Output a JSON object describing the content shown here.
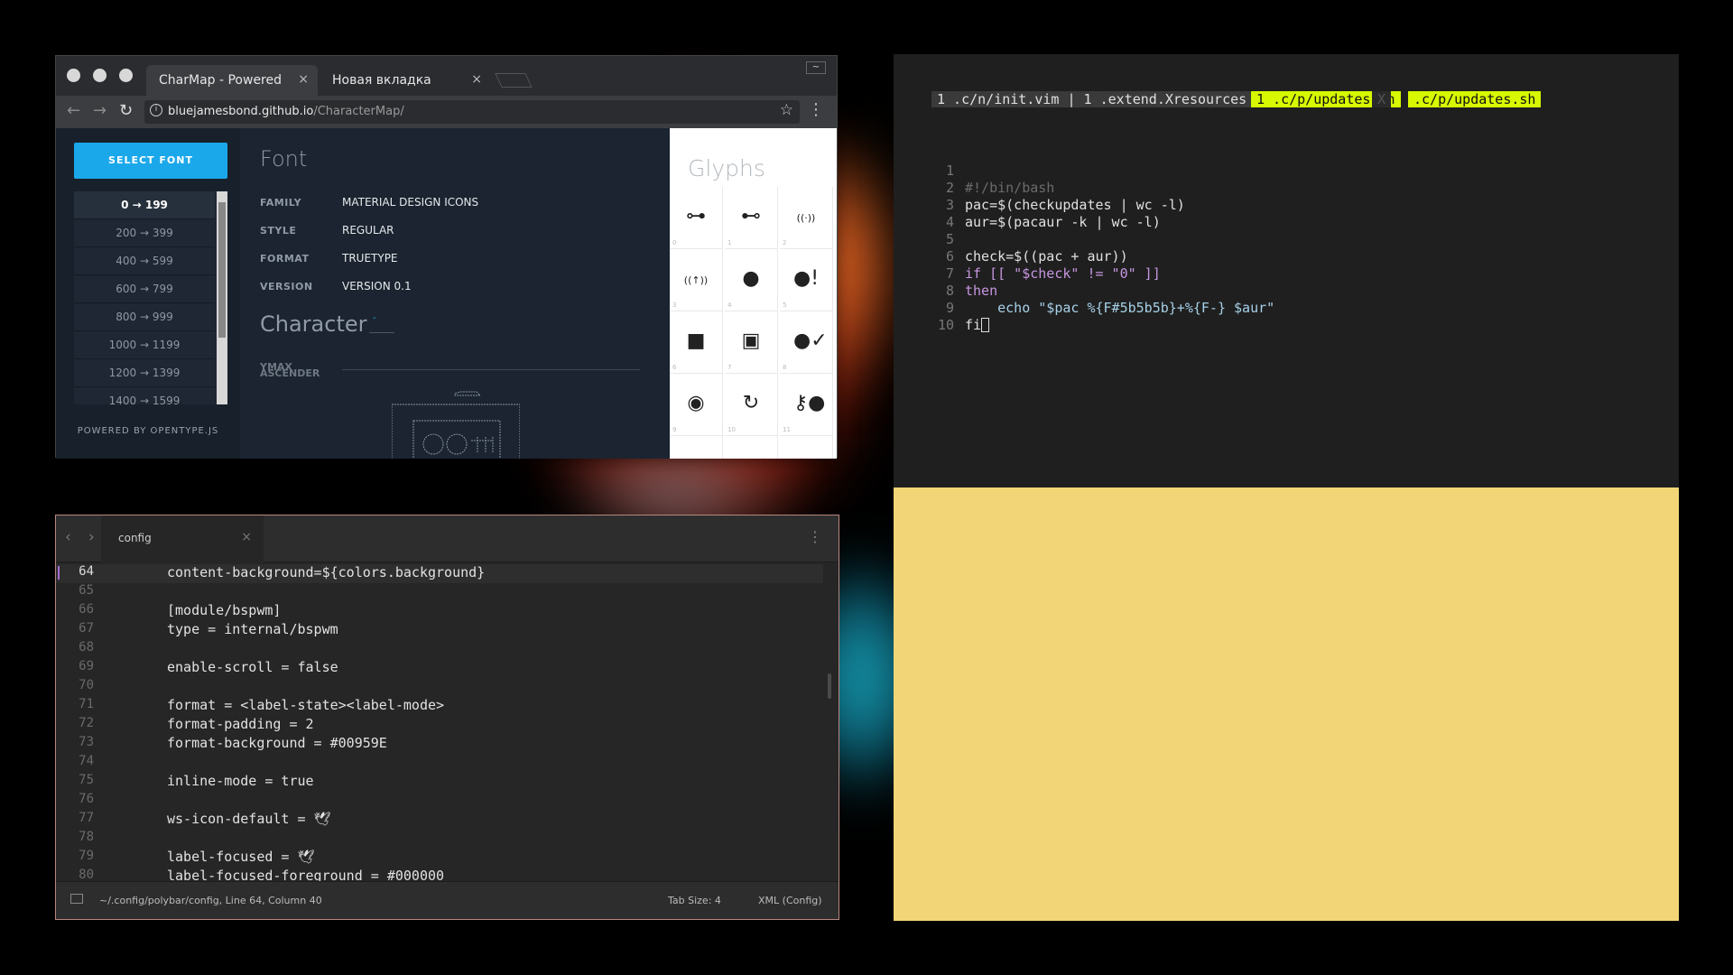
{
  "colors": {
    "accent_blue": "#1ba8ea",
    "vim_tab_highlight": "#d7f800",
    "terminal_bg": "#1f1f1f",
    "yellow_pane": "#f2d576"
  },
  "browser": {
    "tabs": [
      {
        "label": "CharMap - Powered",
        "close": "×"
      },
      {
        "label": "Новая вкладка",
        "close": "×"
      }
    ],
    "url_host": "bluejamesbond.github.io",
    "url_path": "/CharacterMap/",
    "info_icon": "i",
    "minimize": "~",
    "nav": {
      "back": "←",
      "forward": "→",
      "reload": "↻",
      "star": "☆",
      "menu": "⋮"
    }
  },
  "charmap": {
    "select_font_label": "SELECT FONT",
    "ranges": [
      "0 → 199",
      "200 → 399",
      "400 → 599",
      "600 → 799",
      "800 → 999",
      "1000 → 1199",
      "1200 → 1399",
      "1400 → 1599"
    ],
    "active_range": "0 → 199",
    "powered_by": "POWERED BY OPENTYPE.JS",
    "font_heading": "Font",
    "properties": [
      {
        "label": "FAMILY",
        "value": "MATERIAL DESIGN ICONS"
      },
      {
        "label": "STYLE",
        "value": "REGULAR"
      },
      {
        "label": "FORMAT",
        "value": "TRUETYPE"
      },
      {
        "label": "VERSION",
        "value": "VERSION 0.1"
      }
    ],
    "character_heading": "Character",
    "character_value": "-",
    "metrics": [
      "YMAX",
      "ASCENDER"
    ],
    "glyphs_heading": "Glyphs",
    "glyph_cells": [
      {
        "num": "0",
        "icon": "access-point-network-icon",
        "glyph": "⊶"
      },
      {
        "num": "1",
        "icon": "access-point-network-icon",
        "glyph": "⊷"
      },
      {
        "num": "2",
        "icon": "access-point-icon",
        "glyph": "((·))"
      },
      {
        "num": "3",
        "icon": "access-point-tower-icon",
        "glyph": "((↑))"
      },
      {
        "num": "4",
        "icon": "account-icon",
        "glyph": "●"
      },
      {
        "num": "5",
        "icon": "account-alert-icon",
        "glyph": "●!"
      },
      {
        "num": "6",
        "icon": "account-box-icon",
        "glyph": "■"
      },
      {
        "num": "7",
        "icon": "account-box-outline-icon",
        "glyph": "▣"
      },
      {
        "num": "8",
        "icon": "account-check-icon",
        "glyph": "●✓"
      },
      {
        "num": "9",
        "icon": "account-circle-icon",
        "glyph": "◉"
      },
      {
        "num": "10",
        "icon": "account-convert-icon",
        "glyph": "↻"
      },
      {
        "num": "11",
        "icon": "account-key-icon",
        "glyph": "⚷●"
      },
      {
        "num": "",
        "icon": "account-location-icon",
        "glyph": "■"
      },
      {
        "num": "",
        "icon": "account-minus-icon",
        "glyph": "−●"
      },
      {
        "num": "",
        "icon": "account-multiple-icon",
        "glyph": "●●"
      }
    ]
  },
  "editor": {
    "tab_label": "config",
    "tab_close": "×",
    "nav_back": "‹",
    "nav_forward": "›",
    "more": "⋮",
    "lines": [
      {
        "n": "64",
        "code": "content-background=${colors.background}"
      },
      {
        "n": "65",
        "code": ""
      },
      {
        "n": "66",
        "code": "[module/bspwm]"
      },
      {
        "n": "67",
        "code": "type = internal/bspwm"
      },
      {
        "n": "68",
        "code": ""
      },
      {
        "n": "69",
        "code": "enable-scroll = false"
      },
      {
        "n": "70",
        "code": ""
      },
      {
        "n": "71",
        "code": "format = <label-state><label-mode>"
      },
      {
        "n": "72",
        "code": "format-padding = 2"
      },
      {
        "n": "73",
        "code": "format-background = #00959E"
      },
      {
        "n": "74",
        "code": ""
      },
      {
        "n": "75",
        "code": "inline-mode = true"
      },
      {
        "n": "76",
        "code": ""
      },
      {
        "n": "77",
        "code": "ws-icon-default = 🕊"
      },
      {
        "n": "78",
        "code": ""
      },
      {
        "n": "79",
        "code": "label-focused = 🕊"
      },
      {
        "n": "80",
        "code": "label-focused-foreground = #000000"
      }
    ],
    "status": {
      "path": "~/.config/polybar/config, Line 64, Column 40",
      "tab_size": "Tab Size: 4",
      "syntax": "XML (Config)"
    }
  },
  "terminal": {
    "tabline": [
      {
        "text": "1 .c/n/init.vim | 1 .extend.Xresources",
        "style": "inactive"
      },
      {
        "text": "1 .c/p/updates.sh",
        "style": "active"
      },
      {
        "text": "X",
        "style": "dim"
      },
      {
        "text": ".c/p/updates.sh",
        "style": "active"
      }
    ],
    "lines": [
      {
        "n": "1",
        "code": ""
      },
      {
        "n": "2",
        "code": "#!/bin/bash"
      },
      {
        "n": "3",
        "code": "pac=$(checkupdates | wc -l)"
      },
      {
        "n": "4",
        "code": "aur=$(pacaur -k | wc -l)"
      },
      {
        "n": "5",
        "code": ""
      },
      {
        "n": "6",
        "code": "check=$((pac + aur))"
      },
      {
        "n": "7",
        "code": "if [[ \"$check\" != \"0\" ]]"
      },
      {
        "n": "8",
        "code": "then"
      },
      {
        "n": "9",
        "code": "    echo \"$pac %{F#5b5b5b}+%{F-} $aur\""
      },
      {
        "n": "10",
        "code": "fi"
      }
    ]
  }
}
